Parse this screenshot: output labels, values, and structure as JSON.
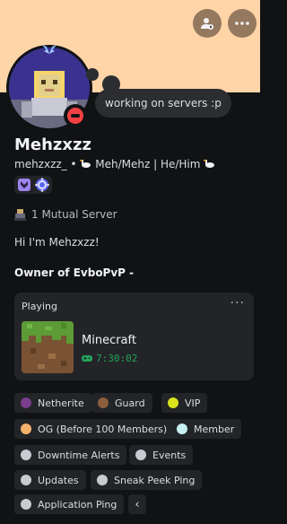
{
  "profile": {
    "display_name": "Mehzxzz",
    "username": "mehzxzz_",
    "pronouns": "Meh/Mehz | He/Him",
    "custom_status": "working on servers :p",
    "mutual_servers": "1 Mutual Server",
    "bio_line1": "Hi I'm Mehzxzz!",
    "bio_line2": "Owner of EvboPvP -"
  },
  "activity": {
    "heading": "Playing",
    "game": "Minecraft",
    "elapsed": "7:30:02"
  },
  "roles": [
    {
      "label": "Netherite",
      "color": "#7a3e8c"
    },
    {
      "label": "Guard",
      "color": "#8b5e3c"
    },
    {
      "label": "VIP",
      "color": "#d9e21a"
    },
    {
      "label": "OG (Before 100 Members)",
      "color": "#f5b06a"
    },
    {
      "label": "Member",
      "color": "#c6f0f2"
    },
    {
      "label": "Downtime Alerts",
      "color": "#c9cbd0"
    },
    {
      "label": "Events",
      "color": "#c9cbd0"
    },
    {
      "label": "Updates",
      "color": "#c9cbd0"
    },
    {
      "label": "Sneak Peek Ping",
      "color": "#c9cbd0"
    },
    {
      "label": "Application Ping",
      "color": "#c9cbd0"
    }
  ],
  "roles_more_label": "‹",
  "activity_more_label": "···",
  "colors": {
    "banner": "#ffd5a8",
    "background": "#111214",
    "card": "#232428",
    "dnd": "#f23f43",
    "playing_green": "#23a55a"
  }
}
